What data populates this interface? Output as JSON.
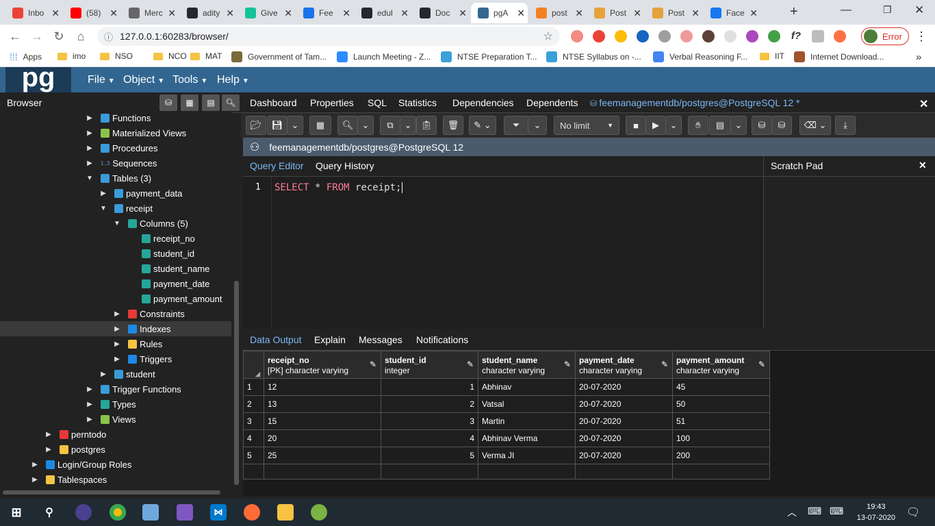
{
  "browser": {
    "tabs": [
      {
        "label": "Inbo",
        "icon": "gmail-icon",
        "color": "#ea4335"
      },
      {
        "label": "(58)",
        "icon": "youtube-icon",
        "color": "#ff0000"
      },
      {
        "label": "Merc",
        "icon": "globe-icon",
        "color": "#666666"
      },
      {
        "label": "adity",
        "icon": "github-icon",
        "color": "#24292e"
      },
      {
        "label": "Give",
        "icon": "grammarly-icon",
        "color": "#15c39a"
      },
      {
        "label": "Fee",
        "icon": "share-icon",
        "color": "#1a73e8"
      },
      {
        "label": "edul",
        "icon": "github-icon",
        "color": "#24292e"
      },
      {
        "label": "Doc",
        "icon": "github-icon",
        "color": "#24292e"
      },
      {
        "label": "pgA",
        "icon": "pgadmin-icon",
        "color": "#336791"
      },
      {
        "label": "post",
        "icon": "stackoverflow-icon",
        "color": "#f48024"
      },
      {
        "label": "Post",
        "icon": "postgres-tutorial-icon",
        "color": "#e6a23c"
      },
      {
        "label": "Post",
        "icon": "postgres-tutorial-icon",
        "color": "#e6a23c"
      },
      {
        "label": "Face",
        "icon": "facebook-icon",
        "color": "#1877f2"
      }
    ],
    "new_tab": "+",
    "url": "127.0.0.1:60283/browser/",
    "error_label": "Error",
    "bookmarks": [
      {
        "label": "Apps",
        "type": "apps"
      },
      {
        "label": "imo",
        "type": "folder"
      },
      {
        "label": "NSO",
        "type": "folder"
      },
      {
        "label": "NCO",
        "type": "folder"
      },
      {
        "label": "MAT",
        "type": "folder"
      },
      {
        "label": "Government of Tam...",
        "type": "site",
        "color": "#7a6a3a"
      },
      {
        "label": "Launch Meeting - Z...",
        "type": "site",
        "color": "#2d8cff"
      },
      {
        "label": "NTSE Preparation T...",
        "type": "site",
        "color": "#3aa0d8"
      },
      {
        "label": "NTSE Syllabus on -...",
        "type": "site",
        "color": "#3aa0d8"
      },
      {
        "label": "Verbal Reasoning F...",
        "type": "site",
        "color": "#4285f4"
      },
      {
        "label": "IIT",
        "type": "folder"
      },
      {
        "label": "Internet Download...",
        "type": "site",
        "color": "#a0522d"
      }
    ],
    "more": "»"
  },
  "pgadmin": {
    "logo": "pg",
    "menu": [
      "File",
      "Object",
      "Tools",
      "Help"
    ],
    "browser_title": "Browser",
    "tree": [
      {
        "label": "Functions",
        "level": 2,
        "chev": "›",
        "color": "#3a9bd9"
      },
      {
        "label": "Materialized Views",
        "level": 2,
        "chev": "›",
        "color": "#8bc34a"
      },
      {
        "label": "Procedures",
        "level": 2,
        "chev": "›",
        "color": "#3a9bd9"
      },
      {
        "label": "Sequences",
        "level": 2,
        "chev": "›",
        "color": "#3a9bd9",
        "prefix": "1..3"
      },
      {
        "label": "Tables (3)",
        "level": 2,
        "chev": "⌄",
        "color": "#3a9bd9"
      },
      {
        "label": "payment_data",
        "level": 3,
        "chev": "›",
        "color": "#3a9bd9"
      },
      {
        "label": "receipt",
        "level": 3,
        "chev": "⌄",
        "color": "#3a9bd9"
      },
      {
        "label": "Columns (5)",
        "level": 4,
        "chev": "⌄",
        "color": "#26a69a"
      },
      {
        "label": "receipt_no",
        "level": 5,
        "chev": "",
        "color": "#26a69a"
      },
      {
        "label": "student_id",
        "level": 5,
        "chev": "",
        "color": "#26a69a"
      },
      {
        "label": "student_name",
        "level": 5,
        "chev": "",
        "color": "#26a69a"
      },
      {
        "label": "payment_date",
        "level": 5,
        "chev": "",
        "color": "#26a69a"
      },
      {
        "label": "payment_amount",
        "level": 5,
        "chev": "",
        "color": "#26a69a"
      },
      {
        "label": "Constraints",
        "level": 4,
        "chev": "›",
        "color": "#e53935"
      },
      {
        "label": "Indexes",
        "level": 4,
        "chev": "›",
        "color": "#1e88e5",
        "selected": true
      },
      {
        "label": "Rules",
        "level": 4,
        "chev": "›",
        "color": "#f6c342"
      },
      {
        "label": "Triggers",
        "level": 4,
        "chev": "›",
        "color": "#1e88e5"
      },
      {
        "label": "student",
        "level": 3,
        "chev": "›",
        "color": "#3a9bd9"
      },
      {
        "label": "Trigger Functions",
        "level": 2,
        "chev": "›",
        "color": "#3a9bd9"
      },
      {
        "label": "Types",
        "level": 2,
        "chev": "›",
        "color": "#26a69a"
      },
      {
        "label": "Views",
        "level": 2,
        "chev": "›",
        "color": "#8bc34a"
      },
      {
        "label": "perntodo",
        "level": 1,
        "chev": "›",
        "color": "#e53935"
      },
      {
        "label": "postgres",
        "level": 1,
        "chev": "›",
        "color": "#f6c342"
      },
      {
        "label": "Login/Group Roles",
        "level": 0,
        "chev": "›",
        "color": "#1e88e5"
      },
      {
        "label": "Tablespaces",
        "level": 0,
        "chev": "›",
        "color": "#f6c342"
      }
    ],
    "main_tabs": [
      "Dashboard",
      "Properties",
      "SQL",
      "Statistics",
      "Dependencies",
      "Dependents"
    ],
    "active_tab": "feemanagementdb/postgres@PostgreSQL 12 *",
    "limit": "No limit",
    "connection": "feemanagementdb/postgres@PostgreSQL 12",
    "query_tabs": [
      "Query Editor",
      "Query History"
    ],
    "scratch_pad": "Scratch Pad",
    "editor": {
      "line": "1",
      "tokens": [
        {
          "t": "SELECT",
          "k": "kw"
        },
        {
          "t": " * ",
          "k": "pl"
        },
        {
          "t": "FROM",
          "k": "kw"
        },
        {
          "t": " receipt;",
          "k": "pl"
        }
      ]
    },
    "output_tabs": [
      "Data Output",
      "Explain",
      "Messages",
      "Notifications"
    ],
    "columns": [
      {
        "name": "receipt_no",
        "type": "[PK] character varying"
      },
      {
        "name": "student_id",
        "type": "integer"
      },
      {
        "name": "student_name",
        "type": "character varying"
      },
      {
        "name": "payment_date",
        "type": "character varying"
      },
      {
        "name": "payment_amount",
        "type": "character varying"
      }
    ],
    "rows": [
      [
        "1",
        "12",
        "1",
        "Abhinav",
        "20-07-2020",
        "45"
      ],
      [
        "2",
        "13",
        "2",
        "Vatsal",
        "20-07-2020",
        "50"
      ],
      [
        "3",
        "15",
        "3",
        "Martin",
        "20-07-2020",
        "51"
      ],
      [
        "4",
        "20",
        "4",
        "Abhinav Verma",
        "20-07-2020",
        "100"
      ],
      [
        "5",
        "25",
        "5",
        "Verma JI",
        "20-07-2020",
        "200"
      ]
    ]
  },
  "taskbar": {
    "time": "19:43",
    "date": "13-07-2020"
  }
}
